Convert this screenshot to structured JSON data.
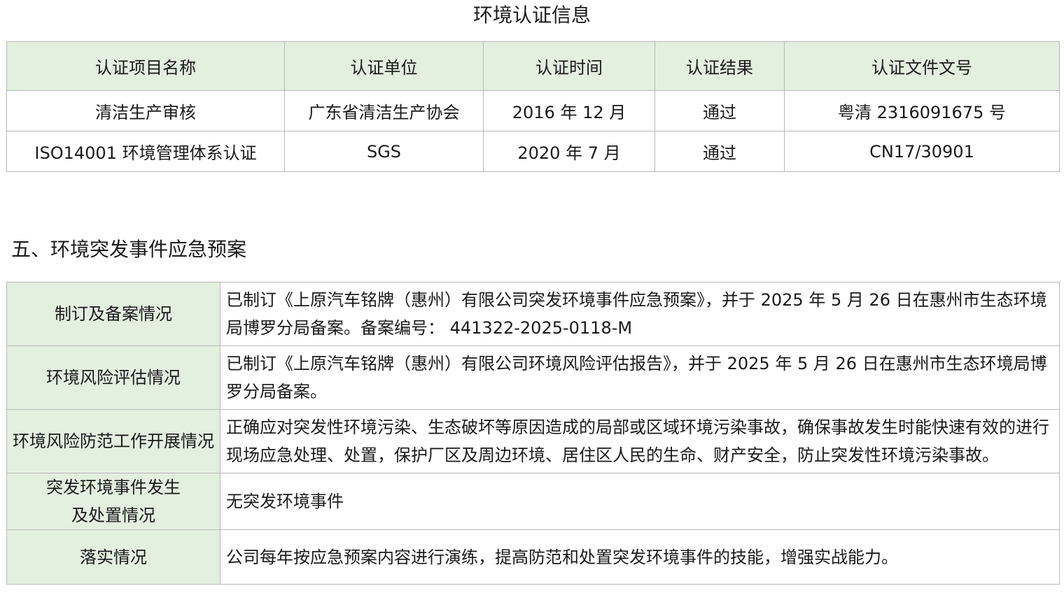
{
  "cert": {
    "title": "环境认证信息",
    "headers": [
      "认证项目名称",
      "认证单位",
      "认证时间",
      "认证结果",
      "认证文件文号"
    ],
    "rows": [
      [
        "清洁生产审核",
        "广东省清洁生产协会",
        "2016 年 12 月",
        "通过",
        "粤清 2316091675 号"
      ],
      [
        "ISO14001 环境管理体系认证",
        "SGS",
        "2020 年 7 月",
        "通过",
        "CN17/30901"
      ]
    ]
  },
  "plan": {
    "heading": "五、环境突发事件应急预案",
    "rows": [
      {
        "label": "制订及备案情况",
        "value": "已制订《上原汽车铭牌（惠州）有限公司突发环境事件应急预案》，并于 2025 年 5 月 26 日在惠州市生态环境局博罗分局备案。备案编号：  441322-2025-0118-M"
      },
      {
        "label": "环境风险评估情况",
        "value": "已制订《上原汽车铭牌（惠州）有限公司环境风险评估报告》，并于 2025 年 5 月 26 日在惠州市生态环境局博罗分局备案。"
      },
      {
        "label": "环境风险防范工作开展情况",
        "value": "正确应对突发性环境污染、生态破坏等原因造成的局部或区域环境污染事故，确保事故发生时能快速有效的进行现场应急处理、处置，保护厂区及周边环境、居住区人民的生命、财产安全，防止突发性环境污染事故。"
      },
      {
        "label": "突发环境事件发生\n及处置情况",
        "value": "无突发环境事件"
      },
      {
        "label": "落实情况",
        "value": "公司每年按应急预案内容进行演练，提高防范和处置突发环境事件的技能，增强实战能力。"
      }
    ]
  }
}
